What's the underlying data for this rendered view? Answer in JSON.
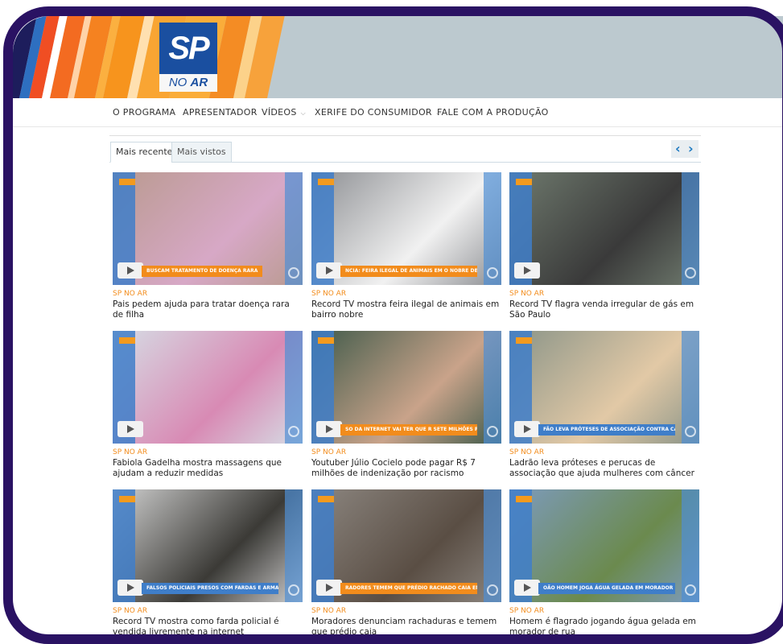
{
  "logo": {
    "main": "SP",
    "sub_prefix": "NO ",
    "sub_bold": "AR"
  },
  "nav": {
    "items": [
      {
        "label": "O PROGRAMA",
        "dropdown": false
      },
      {
        "label": "APRESENTADOR",
        "dropdown": false
      },
      {
        "label": "VÍDEOS",
        "dropdown": true
      },
      {
        "label": "XERIFE DO CONSUMIDOR",
        "dropdown": true
      },
      {
        "label": "FALE COM A PRODUÇÃO",
        "dropdown": false
      }
    ]
  },
  "tabs": {
    "recent": "Mais recentes",
    "most_viewed": "Mais vistos",
    "active": "recent"
  },
  "pager": {
    "prev": "‹",
    "next": "›"
  },
  "videos": [
    {
      "tag": "SP NO AR",
      "title": "Pais pedem ajuda para tratar doença rara de filha",
      "overlay": "BUSCAM TRATAMENTO DE DOENÇA RARA",
      "bg": "#b99a8f",
      "accent": "#d7a8c6"
    },
    {
      "tag": "SP NO AR",
      "title": "Record TV mostra feira ilegal de animais em bairro nobre",
      "overlay": "NCIA: FEIRA ILEGAL DE ANIMAIS EM O NOBRE DE SP VENDE CÃO DOENTE",
      "bg": "#8d8f93",
      "accent": "#f1f1f1"
    },
    {
      "tag": "SP NO AR",
      "title": "Record TV flagra venda irregular de gás em São Paulo",
      "overlay": "",
      "bg": "#6f7a6e",
      "accent": "#3a3a3a"
    },
    {
      "tag": "SP NO AR",
      "title": "Fabiola Gadelha mostra massagens que ajudam a reduzir medidas",
      "overlay": "",
      "bg": "#d6dde5",
      "accent": "#d88ab4"
    },
    {
      "tag": "SP NO AR",
      "title": "Youtuber Júlio Cocielo pode pagar R$ 7 milhões de indenização por racismo",
      "overlay": "SO DA INTERNET VAI TER QUE R SETE MILHÕES POR RACISMO",
      "bg": "#3f5a4a",
      "accent": "#c9a38a"
    },
    {
      "tag": "SP NO AR",
      "title": "Ladrão leva próteses e perucas de associação que ajuda mulheres com câncer",
      "overlay": "FÃO LEVA PRÓTESES DE ASSOCIAÇÃO CONTRA CÂNCER",
      "bg": "#8a9488",
      "accent": "#e2c9a6"
    },
    {
      "tag": "SP NO AR",
      "title": "Record TV mostra como farda policial é vendida livremente na internet",
      "overlay": "FALSOS POLICIAIS PRESOS COM FARDAS E ARMAS",
      "bg": "#d0d0d0",
      "accent": "#3b3a36"
    },
    {
      "tag": "SP NO AR",
      "title": "Moradores denunciam rachaduras e temem que prédio caia",
      "overlay": "RADORES TEMEM QUE PRÉDIO RACHADO CAIA EM SP",
      "bg": "#8c8680",
      "accent": "#5a4e44"
    },
    {
      "tag": "SP NO AR",
      "title": "Homem é flagrado jogando água gelada em morador de rua",
      "overlay": "OÃO HOMEM JOGA ÁGUA GELADA EM MORADOR DE RUA",
      "bg": "#7d9bbd",
      "accent": "#6b8a4e"
    }
  ]
}
